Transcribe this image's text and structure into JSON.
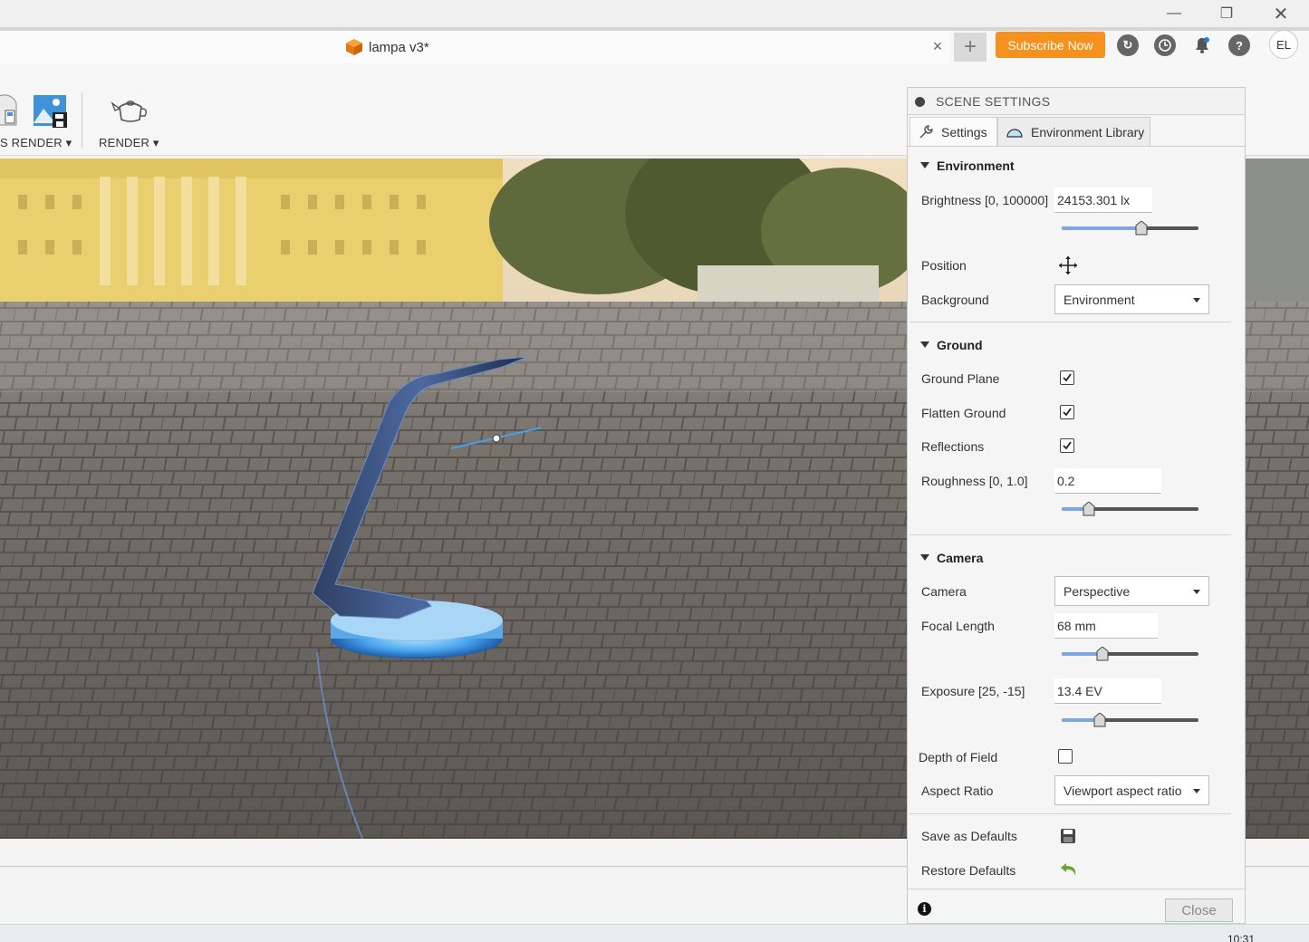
{
  "window": {
    "min_icon": "minimize-icon",
    "restore_icon": "restore-icon",
    "close_icon": "close-icon"
  },
  "tab": {
    "title": "lampa v3*",
    "icon": "cube-icon",
    "close": "×"
  },
  "header": {
    "new_tab": "+",
    "subscribe_label": "Subscribe Now",
    "avatar_initials": "EL",
    "accent": "#f5921e",
    "icons": [
      "sync-icon",
      "clock-icon",
      "bell-icon",
      "help-icon"
    ]
  },
  "toolbar": {
    "render_left_label": "S RENDER ▾",
    "render_label": "RENDER ▾"
  },
  "panel": {
    "title": "SCENE SETTINGS",
    "tabs": [
      {
        "label": "Settings",
        "icon": "wrench-icon"
      },
      {
        "label": "Environment Library",
        "icon": "environment-icon"
      }
    ],
    "environment": {
      "heading": "Environment",
      "brightness_label": "Brightness [0, 100000]",
      "brightness_value": "24153.301 lx",
      "brightness_level": 0.58,
      "position_label": "Position",
      "background_label": "Background",
      "background_value": "Environment"
    },
    "ground": {
      "heading": "Ground",
      "ground_plane_label": "Ground Plane",
      "ground_plane": true,
      "flatten_label": "Flatten Ground",
      "flatten": true,
      "reflections_label": "Reflections",
      "reflections": true,
      "roughness_label": "Roughness [0, 1.0]",
      "roughness_value": "0.2",
      "roughness_level": 0.2
    },
    "camera": {
      "heading": "Camera",
      "camera_label": "Camera",
      "camera_value": "Perspective",
      "focal_label": "Focal Length",
      "focal_value": "68 mm",
      "focal_level": 0.3,
      "exposure_label": "Exposure [25, -15]",
      "exposure_value": "13.4 EV",
      "exposure_level": 0.28,
      "dof_label": "Depth of Field",
      "dof": false,
      "aspect_label": "Aspect Ratio",
      "aspect_value": "Viewport aspect ratio"
    },
    "save_defaults_label": "Save as Defaults",
    "restore_defaults_label": "Restore Defaults",
    "close_label": "Close"
  },
  "taskbar": {
    "time": "10:31"
  }
}
